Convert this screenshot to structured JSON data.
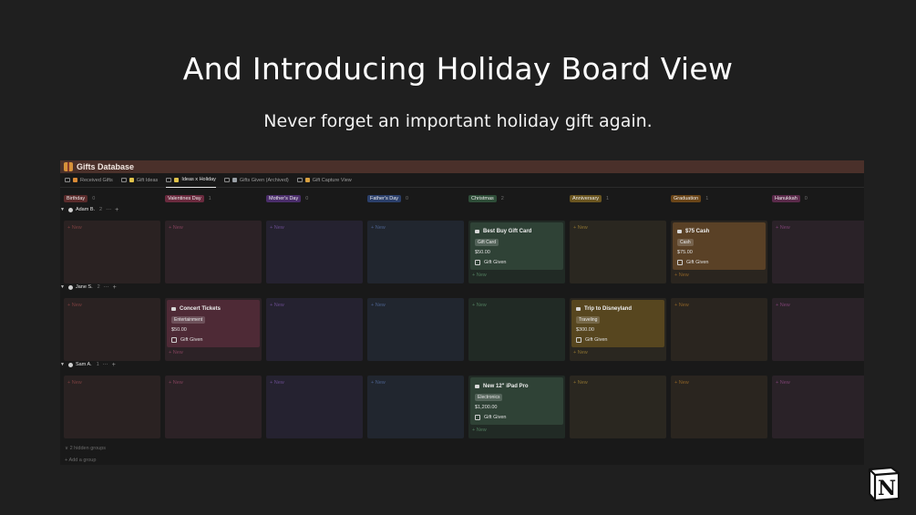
{
  "hero": {
    "title": "And Introducing Holiday Board View",
    "subtitle": "Never forget an important holiday gift again."
  },
  "database": {
    "title": "Gifts Database",
    "tabs": [
      {
        "label": "Received Gifts"
      },
      {
        "label": "Gift Ideas"
      },
      {
        "label": "Ideas x Holiday",
        "active": true
      },
      {
        "label": "Gifts Given (Archived)"
      },
      {
        "label": "Gift Capture View"
      }
    ]
  },
  "columns": [
    {
      "label": "Birthday",
      "count": "0",
      "pill": "#5a2b2b",
      "cell": "#2a2222",
      "newc": "#7a3f3f"
    },
    {
      "label": "Valentines Day",
      "count": "1",
      "pill": "#6a2a3e",
      "cell": "#2c2226",
      "newc": "#80405a"
    },
    {
      "label": "Mother's Day",
      "count": "0",
      "pill": "#4a2d6a",
      "cell": "#252230",
      "newc": "#664a8a"
    },
    {
      "label": "Father's Day",
      "count": "0",
      "pill": "#2b3f6a",
      "cell": "#21262f",
      "newc": "#4a5f8a"
    },
    {
      "label": "Christmas",
      "count": "2",
      "pill": "#2e4d38",
      "cell": "#212a25",
      "newc": "#4f7a5c"
    },
    {
      "label": "Anniversary",
      "count": "1",
      "pill": "#6a5520",
      "cell": "#2a2720",
      "newc": "#8a7030"
    },
    {
      "label": "Graduation",
      "count": "1",
      "pill": "#6a4518",
      "cell": "#2a251f",
      "newc": "#8a6026"
    },
    {
      "label": "Hanukkah",
      "count": "0",
      "pill": "#5a2a4a",
      "cell": "#2a2228",
      "newc": "#7a4070"
    }
  ],
  "new_label": "New",
  "groups": [
    {
      "name": "Adam B.",
      "count": "2"
    },
    {
      "name": "Jane S.",
      "count": "2"
    },
    {
      "name": "Sam A.",
      "count": "1"
    }
  ],
  "cards": [
    {
      "group": 0,
      "col": 4,
      "title": "Best Buy Gift Card",
      "tag": "Gift Card",
      "price": "$50.00",
      "check": "Gift Given",
      "bg": "#2f4236"
    },
    {
      "group": 0,
      "col": 6,
      "title": "$75 Cash",
      "tag": "Cash",
      "price": "$75.00",
      "check": "Gift Given",
      "bg": "#5a4126"
    },
    {
      "group": 1,
      "col": 1,
      "title": "Concert Tickets",
      "tag": "Entertainment",
      "price": "$50.00",
      "check": "Gift Given",
      "bg": "#4e2a36"
    },
    {
      "group": 1,
      "col": 5,
      "title": "Trip to Disneyland",
      "tag": "Traveling",
      "price": "$300.00",
      "check": "Gift Given",
      "bg": "#57461f"
    },
    {
      "group": 2,
      "col": 4,
      "title": "New 12\" iPad Pro",
      "tag": "Electronics",
      "price": "$1,200.00",
      "check": "Gift Given",
      "bg": "#2f4236"
    }
  ],
  "footer": {
    "hidden_groups": "2 hidden groups",
    "add_group": "Add a group"
  },
  "logo": {
    "letter": "N"
  }
}
